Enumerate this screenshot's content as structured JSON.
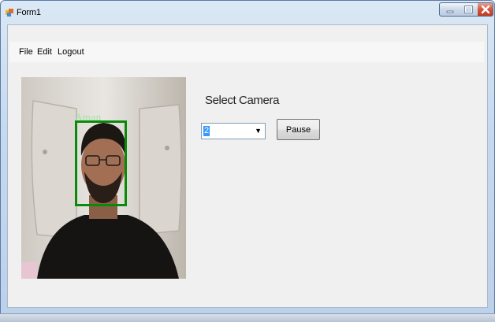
{
  "window": {
    "title": "Form1"
  },
  "menu": {
    "items": [
      "File",
      "Edit",
      "Logout"
    ]
  },
  "camera": {
    "label": "Select Camera",
    "selected_value": "2"
  },
  "buttons": {
    "pause_label": "Pause"
  },
  "video": {
    "detected_name": "Aman",
    "box_color": "#0a8a0a",
    "name_color": "#9ee59e"
  },
  "colors": {
    "title_gradient_top": "#dbe8f5",
    "close_red": "#c23a21",
    "client_bg": "#f0f0f0"
  }
}
